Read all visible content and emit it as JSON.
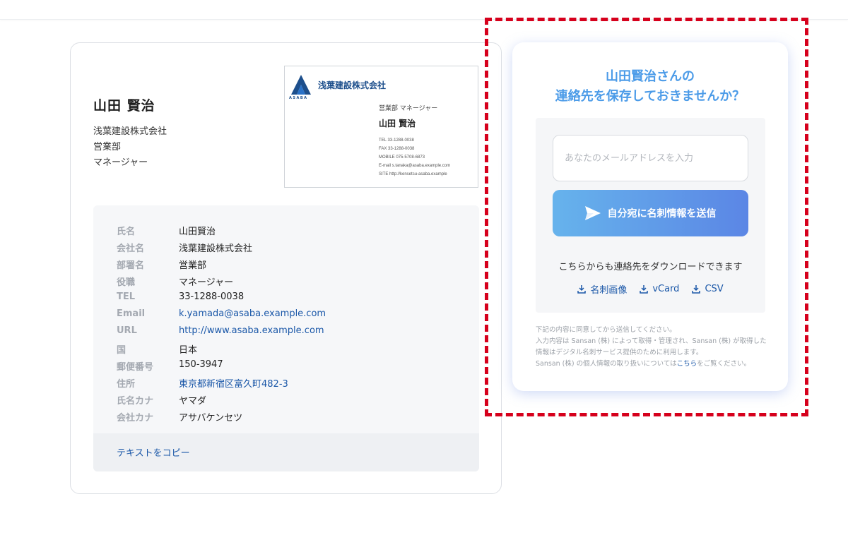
{
  "profile": {
    "name": "山田 賢治",
    "company": "浅葉建設株式会社",
    "department": "営業部",
    "title": "マネージャー"
  },
  "business_card": {
    "logo_text": "ASABA",
    "company": "浅葉建設株式会社",
    "role": "営業部 マネージャー",
    "name": "山田 賢治",
    "tel": "TEL 33-1288-0038",
    "fax": "FAX 33-1288-0038",
    "mobile": "MOBILE 075-5708-6873",
    "email": "E-mail s.tanaka@asaba.example.com",
    "site": "SITE http://kensetsu-asaba.example"
  },
  "details": [
    {
      "label": "氏名",
      "value": "山田賢治",
      "link": false
    },
    {
      "label": "会社名",
      "value": "浅葉建設株式会社",
      "link": false
    },
    {
      "label": "部署名",
      "value": "営業部",
      "link": false
    },
    {
      "label": "役職",
      "value": "マネージャー",
      "link": false
    },
    {
      "label": "TEL",
      "value": "33-1288-0038",
      "link": false
    },
    {
      "label": "Email",
      "value": "k.yamada@asaba.example.com",
      "link": true
    },
    {
      "label": "URL",
      "value": "http://www.asaba.example.com",
      "link": true
    },
    {
      "label": "国",
      "value": "日本",
      "link": false
    },
    {
      "label": "郵便番号",
      "value": "150-3947",
      "link": false
    },
    {
      "label": "住所",
      "value": "東京都新宿区富久町482-3",
      "link": true
    },
    {
      "label": "氏名カナ",
      "value": "ヤマダ",
      "link": false
    },
    {
      "label": "会社カナ",
      "value": "アサバケンセツ",
      "link": false
    }
  ],
  "copy_text_label": "テキストをコピー",
  "save": {
    "title_line1": "山田賢治さんの",
    "title_line2": "連絡先を保存しておきませんか？",
    "email_placeholder": "あなたのメールアドレスを入力",
    "email_value": "",
    "send_label": "自分宛に名刺情報を送信",
    "download_text": "こちらからも連絡先をダウンロードできます",
    "downloads": [
      "名刺画像",
      "vCard",
      "CSV"
    ],
    "consent_line1": "下記の内容に同意してから送信してください。",
    "consent_line2": "入力内容は Sansan (株) によって取得・管理され、Sansan (株) が取得した情報はデジタル名刺サービス提供のために利用します。",
    "consent_line3_pre": "Sansan (株) の個人情報の取り扱いについては",
    "consent_link": "こちら",
    "consent_line3_post": "をご覧ください。"
  },
  "colors": {
    "accent": "#4b9be8",
    "link": "#1a57a8",
    "highlight": "#d6001c",
    "button_start": "#66b3ec",
    "button_end": "#5b86e5"
  },
  "icons": {
    "send": "paper-plane-icon",
    "download": "download-icon",
    "logo": "asaba-logo-icon"
  }
}
